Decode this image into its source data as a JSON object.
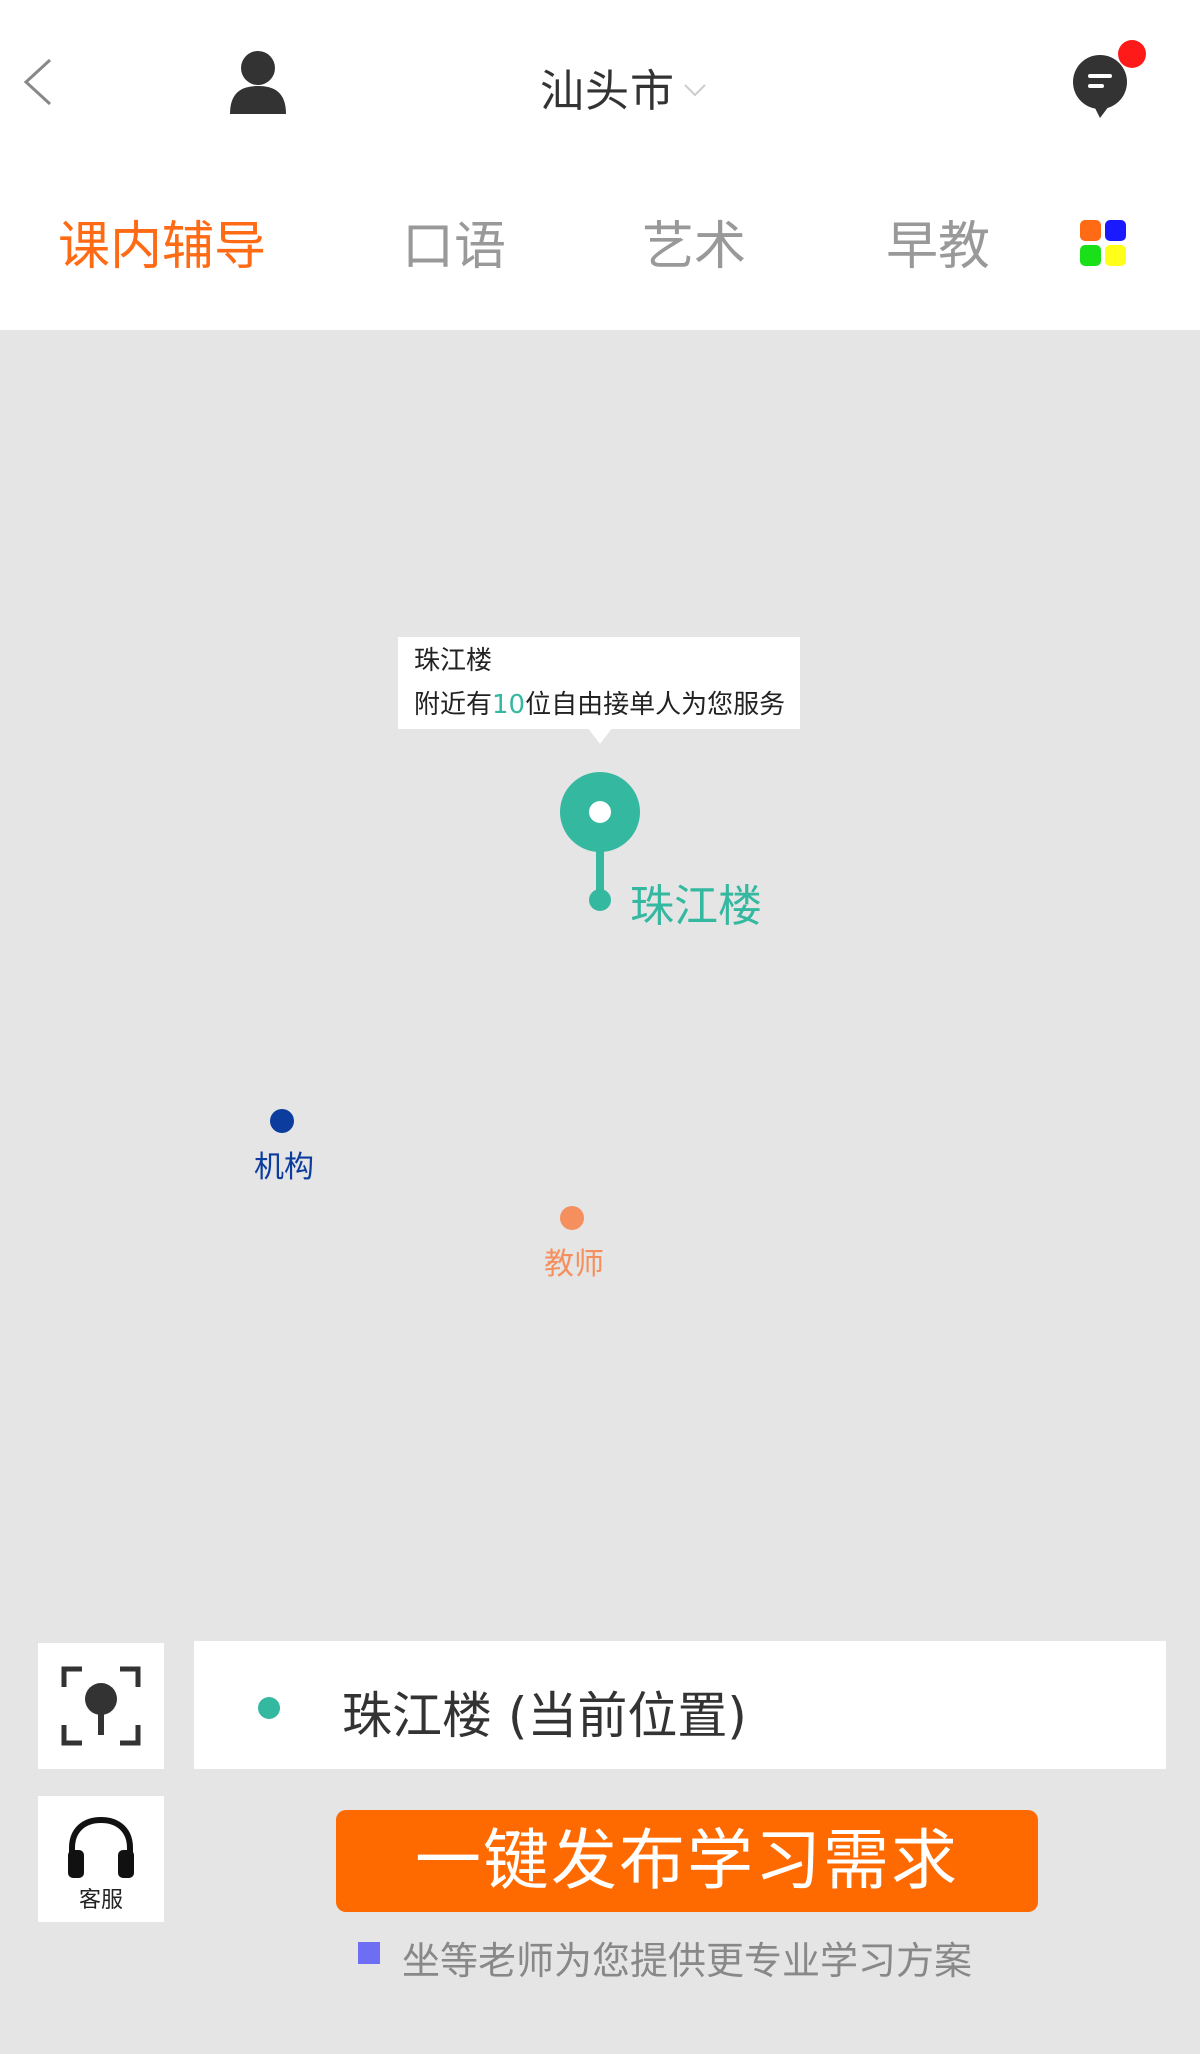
{
  "header": {
    "city": "汕头市",
    "unread_indicator_color": "#ff1a1a",
    "icons": {
      "back": "chevron-left-icon",
      "profile": "user-icon",
      "city_dropdown": "chevron-down-icon",
      "messages": "chat-bubble-icon"
    }
  },
  "tabs": [
    {
      "label": "课内辅导",
      "active": true
    },
    {
      "label": "口语",
      "active": false
    },
    {
      "label": "艺术",
      "active": false
    },
    {
      "label": "早教",
      "active": false
    }
  ],
  "colors": {
    "accent": "#ff6a14",
    "primary_button": "#ff6a00",
    "pin": "#34b8a0",
    "organization": "#0b3c9e",
    "teacher": "#f5905e",
    "grid_menu": [
      "#ff6a14",
      "#1a1aff",
      "#1ae01a",
      "#ffff1a"
    ]
  },
  "map": {
    "info_window": {
      "title": "珠江楼",
      "desc_prefix": "附近有",
      "count": "10",
      "desc_suffix": "位自由接单人为您服务"
    },
    "pin_label": "珠江楼",
    "legend": {
      "organization": "机构",
      "teacher": "教师"
    }
  },
  "bottom": {
    "current_location": "珠江楼 (当前位置)",
    "customer_service_label": "客服",
    "publish_button": "一键发布学习需求",
    "hint": "坐等老师为您提供更专业学习方案",
    "icons": {
      "locate": "locate-icon",
      "customer_service": "headset-icon"
    }
  }
}
